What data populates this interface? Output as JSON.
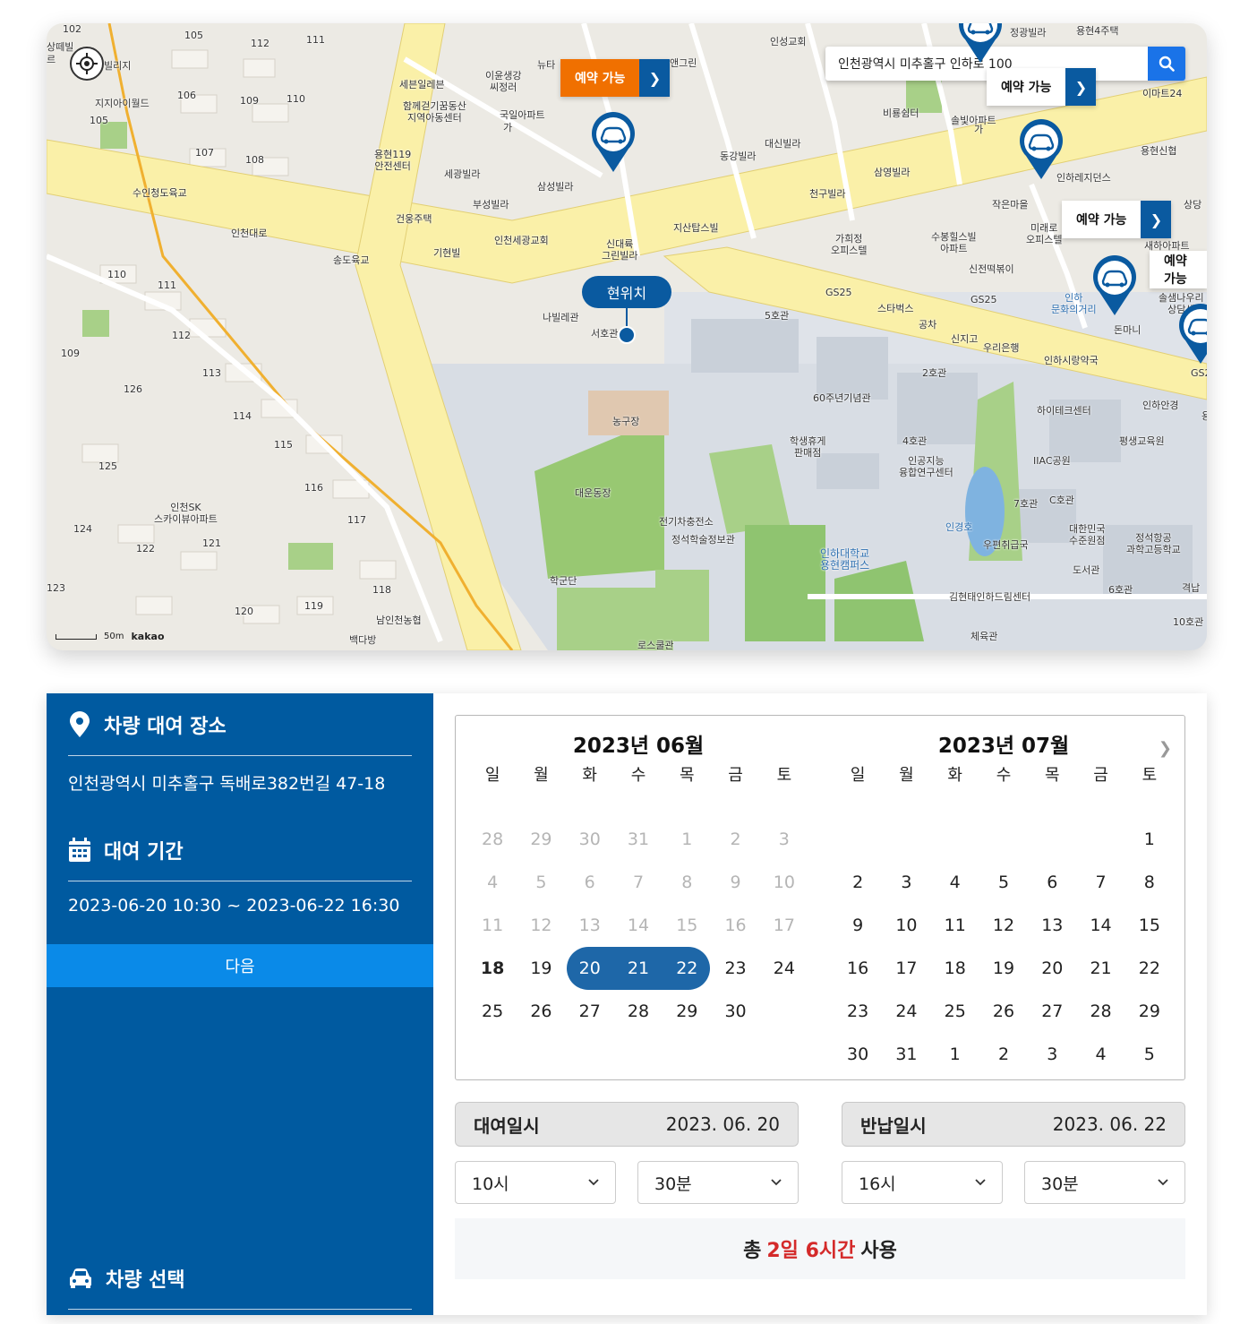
{
  "map": {
    "search_value": "인천광역시 미추홀구 인하로 100",
    "current_location": "현위치",
    "availability_label": "예약 가능",
    "scale_text": "50m",
    "brand": "kakao",
    "labels": {
      "l1": "102",
      "l2": "105",
      "l3": "112",
      "l4": "111",
      "l5": "빌리지",
      "l6": "지지아이월드",
      "l7": "106",
      "l8": "109",
      "l9": "110",
      "l10": "105",
      "l11": "107",
      "l12": "108",
      "l13": "수인청도육교",
      "l14": "인천대로",
      "l15": "송도육교",
      "l16": "세븐일레븐",
      "l17": "이윤생강\n씨정러",
      "l18": "뉴타",
      "l19": "함께걷기꿈동산\n지역아동센터",
      "l20": "국일아파트",
      "l21": "용현119\n안전센터",
      "l22": "세광빌라",
      "l23": "부성빌라",
      "l24": "삼성빌라",
      "l25": "건웅주택",
      "l26": "인천세광교회",
      "l27": "기현빌",
      "l28": "신대륙\n그린빌라",
      "l29": "지산탑스빌",
      "l30": "동강빌라",
      "l31": "대신빌라",
      "l32": "인성교회",
      "l33": "앤그린",
      "l34": "천구빌라",
      "l35": "삼영빌라",
      "l36": "비룡쉼터",
      "l37": "솔빛아파트",
      "l38": "정광빌라",
      "l39": "이마트24",
      "l40": "용현신협",
      "l41": "인하레지던스",
      "l42": "작은마을",
      "l43": "미래로\n오피스텔",
      "l44": "가희정\n오피스텔",
      "l45": "수봉힐스빌\n아파트",
      "l46": "신전떡볶이",
      "l47": "GS25",
      "l48": "GS25",
      "l49": "스타벅스",
      "l50": "공차",
      "l51": "우리은행",
      "l52": "인하\n문화의거리",
      "l53": "돈마니",
      "l54": "인하시랑약국",
      "l55": "인하안경",
      "l56": "하이테크센터",
      "l57": "평생교육원",
      "l58": "IIAC공원",
      "l59": "5호관",
      "l60": "2호관",
      "l61": "60주년기념관",
      "l62": "나빌레관",
      "l63": "서호관",
      "l64": "농구장",
      "l65": "대운동장",
      "l66": "학생휴게\n판매점",
      "l67": "4호관",
      "l68": "인공지능\n융합연구센터",
      "l69": "전기차충전소",
      "l70": "정석학술정보관",
      "l71": "인경호",
      "l72": "7호관",
      "l73": "C호관",
      "l74": "우편취급국",
      "l75": "대한민국\n수준원점",
      "l76": "정석항공\n과학고등학교",
      "l77": "인하대학교\n용현캠퍼스",
      "l78": "도서관",
      "l79": "6호관",
      "l80": "학군단",
      "l81": "김현태인하드림센터",
      "l82": "체육관",
      "l83": "10호관",
      "l84": "로스쿨관",
      "l85": "인천SK\n스카이뷰아파트",
      "l86": "110",
      "l87": "111",
      "l88": "112",
      "l89": "109",
      "l90": "113",
      "l91": "126",
      "l92": "114",
      "l93": "115",
      "l94": "125",
      "l95": "116",
      "l96": "117",
      "l97": "124",
      "l98": "122",
      "l99": "121",
      "l100": "118",
      "l101": "123",
      "l102": "120",
      "l103": "119",
      "l104": "남인천농협",
      "l105": "백다방",
      "l106": "솔샘나우리\n상담센",
      "l107": "새하아파트",
      "l108": "상당",
      "l109": "격납",
      "l110": "GS2",
      "l111": "용현4주택",
      "l112": "상떼빌",
      "l113": "르",
      "l114": "가",
      "l115": "가",
      "l116": "신지고",
      "l117": "용"
    }
  },
  "sidebar": {
    "location_title": "차량 대여 장소",
    "location_value": "인천광역시 미추홀구 독배로382번길 47-18",
    "period_title": "대여 기간",
    "period_value": "2023-06-20 10:30 ~ 2023-06-22 16:30",
    "next_label": "다음",
    "vehicle_title": "차량 선택"
  },
  "calendar": {
    "weekdays": [
      "일",
      "월",
      "화",
      "수",
      "목",
      "금",
      "토"
    ],
    "months": [
      {
        "title": "2023년 06월",
        "days": [
          {
            "d": "28",
            "muted": true
          },
          {
            "d": "29",
            "muted": true
          },
          {
            "d": "30",
            "muted": true
          },
          {
            "d": "31",
            "muted": true
          },
          {
            "d": "1",
            "muted": true
          },
          {
            "d": "2",
            "muted": true
          },
          {
            "d": "3",
            "muted": true
          },
          {
            "d": "4",
            "muted": true
          },
          {
            "d": "5",
            "muted": true
          },
          {
            "d": "6",
            "muted": true
          },
          {
            "d": "7",
            "muted": true
          },
          {
            "d": "8",
            "muted": true
          },
          {
            "d": "9",
            "muted": true
          },
          {
            "d": "10",
            "muted": true
          },
          {
            "d": "11",
            "muted": true
          },
          {
            "d": "12",
            "muted": true
          },
          {
            "d": "13",
            "muted": true
          },
          {
            "d": "14",
            "muted": true
          },
          {
            "d": "15",
            "muted": true
          },
          {
            "d": "16",
            "muted": true
          },
          {
            "d": "17",
            "muted": true
          },
          {
            "d": "18",
            "today": true
          },
          {
            "d": "19"
          },
          {
            "d": "20",
            "selected": true
          },
          {
            "d": "21",
            "selected": true
          },
          {
            "d": "22",
            "selected": true
          },
          {
            "d": "23"
          },
          {
            "d": "24"
          },
          {
            "d": "25"
          },
          {
            "d": "26"
          },
          {
            "d": "27"
          },
          {
            "d": "28"
          },
          {
            "d": "29"
          },
          {
            "d": "30"
          },
          {
            "d": ""
          }
        ]
      },
      {
        "title": "2023년 07월",
        "days": [
          {
            "d": ""
          },
          {
            "d": ""
          },
          {
            "d": ""
          },
          {
            "d": ""
          },
          {
            "d": ""
          },
          {
            "d": ""
          },
          {
            "d": "1"
          },
          {
            "d": "2"
          },
          {
            "d": "3"
          },
          {
            "d": "4"
          },
          {
            "d": "5"
          },
          {
            "d": "6"
          },
          {
            "d": "7"
          },
          {
            "d": "8"
          },
          {
            "d": "9"
          },
          {
            "d": "10"
          },
          {
            "d": "11"
          },
          {
            "d": "12"
          },
          {
            "d": "13"
          },
          {
            "d": "14"
          },
          {
            "d": "15"
          },
          {
            "d": "16"
          },
          {
            "d": "17"
          },
          {
            "d": "18"
          },
          {
            "d": "19"
          },
          {
            "d": "20"
          },
          {
            "d": "21"
          },
          {
            "d": "22"
          },
          {
            "d": "23"
          },
          {
            "d": "24"
          },
          {
            "d": "25"
          },
          {
            "d": "26"
          },
          {
            "d": "27"
          },
          {
            "d": "28"
          },
          {
            "d": "29"
          },
          {
            "d": "30"
          },
          {
            "d": "31"
          },
          {
            "d": "1"
          },
          {
            "d": "2"
          },
          {
            "d": "3"
          },
          {
            "d": "4"
          },
          {
            "d": "5"
          }
        ]
      }
    ]
  },
  "rental": {
    "label": "대여일시",
    "date": "2023. 06. 20",
    "hour": "10시",
    "minute": "30분"
  },
  "return": {
    "label": "반납일시",
    "date": "2023. 06. 22",
    "hour": "16시",
    "minute": "30분"
  },
  "total": {
    "prefix": "총",
    "duration": "2일 6시간",
    "suffix": "사용"
  },
  "colors": {
    "primary": "#005aa0",
    "accent": "#0a8ae8",
    "range": "#1e67a8",
    "orange": "#f07000",
    "highlight": "#d42a2a"
  }
}
